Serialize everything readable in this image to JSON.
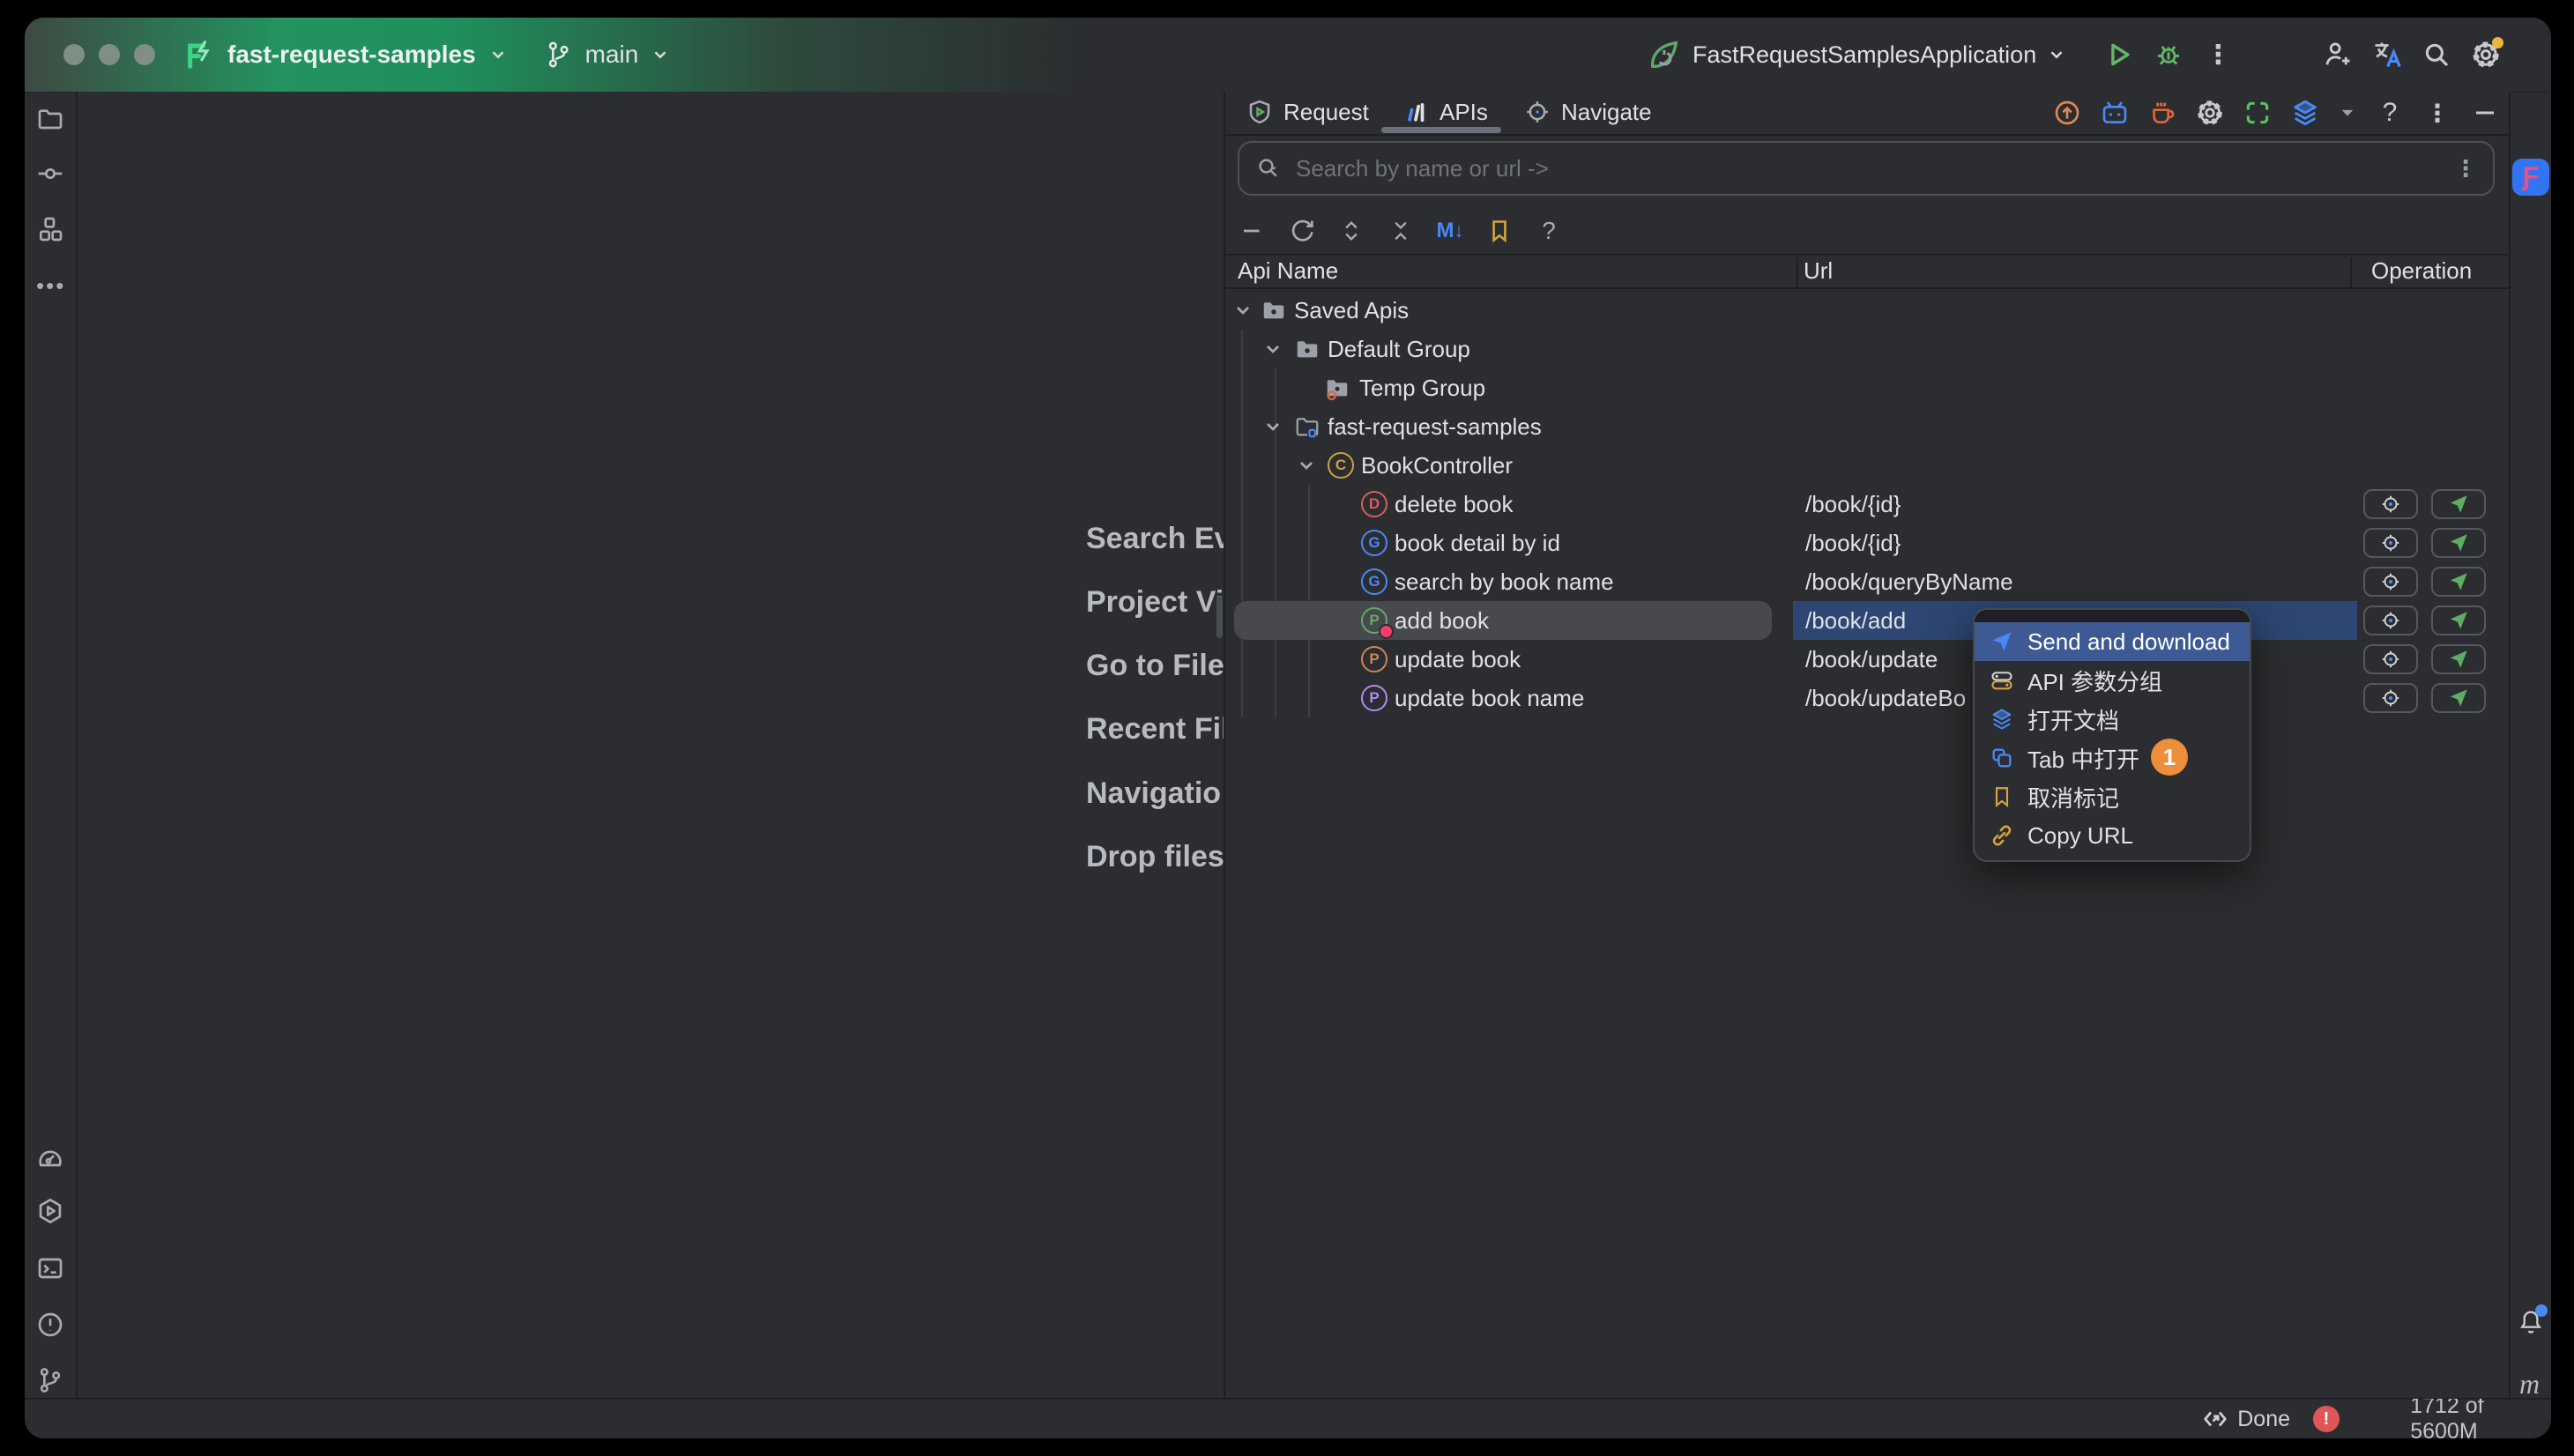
{
  "titlebar": {
    "project_name": "fast-request-samples",
    "branch_name": "main",
    "run_config_name": "FastRequestSamplesApplication",
    "right_icons": [
      "run-icon",
      "debug-icon",
      "more-icon",
      "add-user-icon",
      "translate-icon",
      "search-icon",
      "settings-icon"
    ]
  },
  "left_toolbar_icons": [
    "project-folder-icon",
    "commit-icon",
    "structure-icon",
    "more-icon",
    "profiler-icon",
    "services-icon",
    "terminal-icon",
    "problems-icon",
    "git-branch-icon"
  ],
  "right_toolbar_icons": [
    "fast-request-app-icon",
    "notifications-bell-icon",
    "m-widget"
  ],
  "editor_hints": {
    "lines": [
      "Search Ev",
      "Project Vi",
      "Go to File",
      "Recent Fil",
      "Navigatio",
      "Drop files"
    ]
  },
  "panel": {
    "tabs": [
      {
        "label": "Request",
        "icon": "request-shield-icon",
        "active": false
      },
      {
        "label": "APIs",
        "icon": "apis-chart-icon",
        "active": true
      },
      {
        "label": "Navigate",
        "icon": "navigate-target-icon",
        "active": false
      }
    ],
    "header_icons": [
      "upgrade-icon",
      "tv-icon",
      "coffee-icon",
      "gear-icon",
      "scan-icon",
      "layers-icon",
      "dropdown-caret-icon",
      "help-icon",
      "kebab-icon",
      "hide-icon"
    ],
    "search": {
      "placeholder": "Search by name or url ->"
    },
    "toolbar_icons": [
      "minus-icon",
      "refresh-icon",
      "expand-icon",
      "collapse-icon",
      "markdown-export-icon",
      "bookmark-icon",
      "help-icon"
    ],
    "table": {
      "columns": {
        "api_name": "Api Name",
        "url": "Url",
        "operation": "Operation"
      }
    },
    "tree": {
      "rows": [
        {
          "label": "Saved Apis",
          "type": "folder",
          "expanded": true
        },
        {
          "label": "Default Group",
          "type": "folder",
          "expanded": true
        },
        {
          "label": "Temp Group",
          "type": "folder-temp"
        },
        {
          "label": "fast-request-samples",
          "type": "module",
          "expanded": true
        },
        {
          "label": "BookController",
          "type": "class",
          "letter": "C",
          "expanded": true
        },
        {
          "label": "delete book",
          "url": "/book/{id}",
          "method": "DELETE",
          "letter": "D"
        },
        {
          "label": "book detail by id",
          "url": "/book/{id}",
          "method": "GET",
          "letter": "G"
        },
        {
          "label": "search by book name",
          "url": "/book/queryByName",
          "method": "GET",
          "letter": "G"
        },
        {
          "label": "add book",
          "url": "/book/add",
          "method": "POST",
          "letter": "P",
          "selected": true,
          "bookmarked": true
        },
        {
          "label": "update book",
          "url": "/book/update",
          "method": "PUT",
          "letter": "P"
        },
        {
          "label": "update book name",
          "url": "/book/updateBo",
          "method": "PATCH",
          "letter": "P"
        }
      ]
    }
  },
  "context_menu": {
    "items": [
      {
        "label": "Send and download",
        "icon": "send-icon",
        "selected": true
      },
      {
        "label": "API 参数分组",
        "icon": "param-group-icon"
      },
      {
        "label": "打开文档",
        "icon": "open-doc-icon"
      },
      {
        "label": "Tab 中打开",
        "icon": "open-in-tab-icon",
        "badge": "1"
      },
      {
        "label": "取消标记",
        "icon": "unmark-bookmark-icon"
      },
      {
        "label": "Copy URL",
        "icon": "copy-url-icon"
      }
    ]
  },
  "status_bar": {
    "done_label": "Done",
    "memory_label": "1712 of 5600M"
  },
  "colors": {
    "titlebar_green": "#1f8f5e",
    "panel_bg": "#2b2d30",
    "selection_blue": "#2d4672",
    "menu_selection_blue": "#3d5a94",
    "row_selection_gray": "#47494e",
    "badge_orange": "#ec8e3a",
    "method_get": "#4a88f7",
    "method_post": "#5fad65",
    "method_put": "#d08555",
    "method_delete": "#db5c5c",
    "method_patch": "#b189f5",
    "class_icon_gold": "#cf9f4a",
    "bookmark_yellow": "#d6a343",
    "app_icon_blue": "#3574f0",
    "app_icon_pink": "#f54c7f",
    "error_red": "#e05555",
    "memory_fill_blue": "#3a5490"
  }
}
